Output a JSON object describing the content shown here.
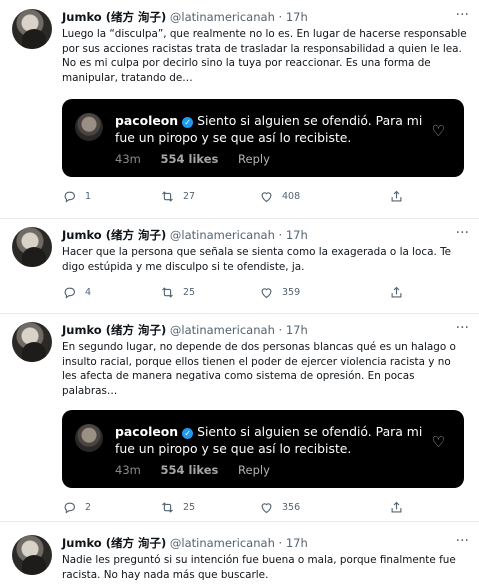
{
  "tweets": [
    {
      "name": "Jumko (绪方 洵子)",
      "handle": "@latinamericanah",
      "dot": "·",
      "time": "17h",
      "text": "Luego la “disculpa”, que realmente no lo es. En lugar de hacerse responsable por sus acciones racistas trata de trasladar la responsabilidad a quien le lea. No es mi culpa por decirlo sino la tuya por reaccionar. Es una forma de manipular, tratando de…",
      "embed": {
        "user": "pacoleon",
        "text": "Siento si alguien se ofendió. Para mi fue un piropo y se que así lo recibiste.",
        "time": "43m",
        "likes": "554 likes",
        "reply": "Reply"
      },
      "replies": "1",
      "retweets": "27",
      "likes": "408"
    },
    {
      "name": "Jumko (绪方 洵子)",
      "handle": "@latinamericanah",
      "dot": "·",
      "time": "17h",
      "text": "Hacer que la persona que señala se sienta como la exagerada o la loca. Te digo estúpida y me disculpo si te ofendiste, ja.",
      "replies": "4",
      "retweets": "25",
      "likes": "359"
    },
    {
      "name": "Jumko (绪方 洵子)",
      "handle": "@latinamericanah",
      "dot": "·",
      "time": "17h",
      "text": "En segundo lugar, no depende de dos personas blancas qué es un halago o insulto racial, porque ellos tienen el poder de ejercer violencia racista y no les afecta de manera negativa como sistema de opresión. En pocas palabras…",
      "embed": {
        "user": "pacoleon",
        "text": "Siento si alguien se ofendió. Para mi fue un piropo y se que así lo recibiste.",
        "time": "43m",
        "likes": "554 likes",
        "reply": "Reply"
      },
      "replies": "2",
      "retweets": "25",
      "likes": "356"
    },
    {
      "name": "Jumko (绪方 洵子)",
      "handle": "@latinamericanah",
      "dot": "·",
      "time": "17h",
      "text": "Nadie les preguntó si su intención fue buena o mala, porque finalmente fue racista. No hay nada más que buscarle."
    }
  ]
}
